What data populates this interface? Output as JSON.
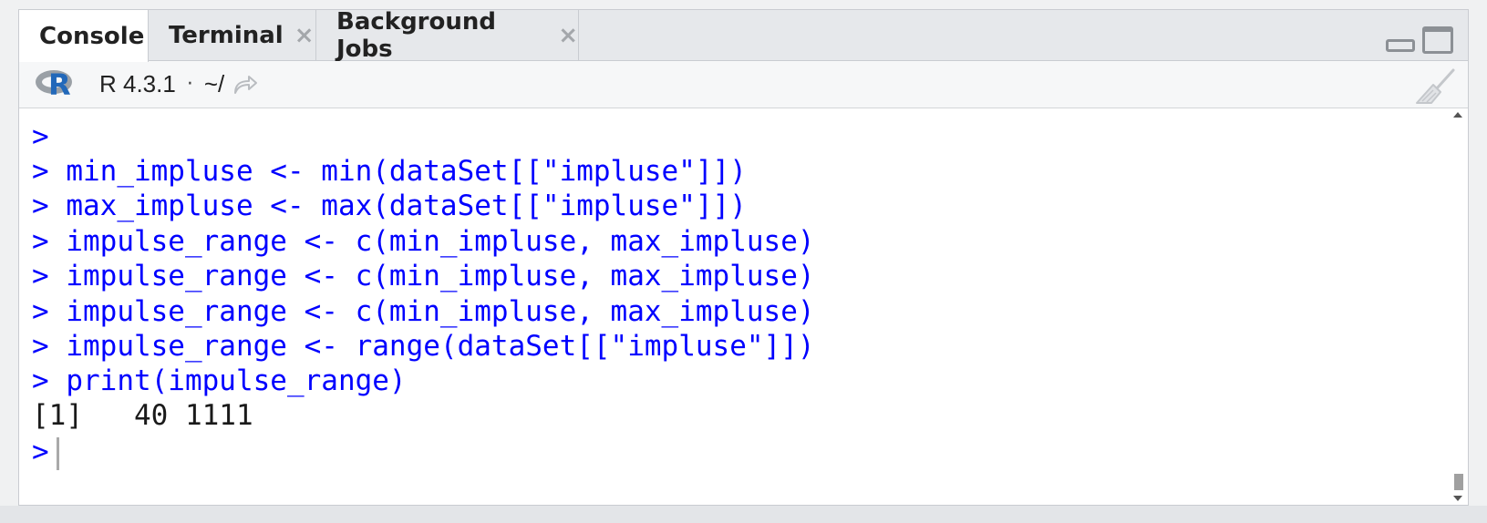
{
  "tabs": [
    {
      "label": "Console",
      "active": true,
      "closable": false
    },
    {
      "label": "Terminal",
      "active": false,
      "closable": true
    },
    {
      "label": "Background Jobs",
      "active": false,
      "closable": true
    }
  ],
  "tab_close_glyph": "×",
  "info_bar": {
    "r_logo_text": "R",
    "r_version": "R 4.3.1",
    "separator": "·",
    "working_dir": "~/"
  },
  "console": {
    "lines": [
      {
        "text": ">",
        "type": "input"
      },
      {
        "text": "> min_impluse <- min(dataSet[[\"impluse\"]])",
        "type": "input"
      },
      {
        "text": "> max_impluse <- max(dataSet[[\"impluse\"]])",
        "type": "input"
      },
      {
        "text": "> impulse_range <- c(min_impluse, max_impluse)",
        "type": "input"
      },
      {
        "text": "> impulse_range <- c(min_impluse, max_impluse)",
        "type": "input"
      },
      {
        "text": "> impulse_range <- c(min_impluse, max_impluse)",
        "type": "input"
      },
      {
        "text": "> impulse_range <- range(dataSet[[\"impluse\"]])",
        "type": "input"
      },
      {
        "text": "> print(impulse_range)",
        "type": "input"
      },
      {
        "text": "[1]   40 1111",
        "type": "output"
      }
    ],
    "prompt": ">"
  },
  "colors": {
    "input_text": "#0000ff",
    "output_text": "#1a1a1a",
    "r_logo_blue": "#2268b9"
  },
  "icons": {
    "r_logo": "r-logo-icon",
    "goto_dir": "goto-directory-icon",
    "clear_console": "broom-icon",
    "minimize": "minimize-icon",
    "maximize": "maximize-icon"
  }
}
